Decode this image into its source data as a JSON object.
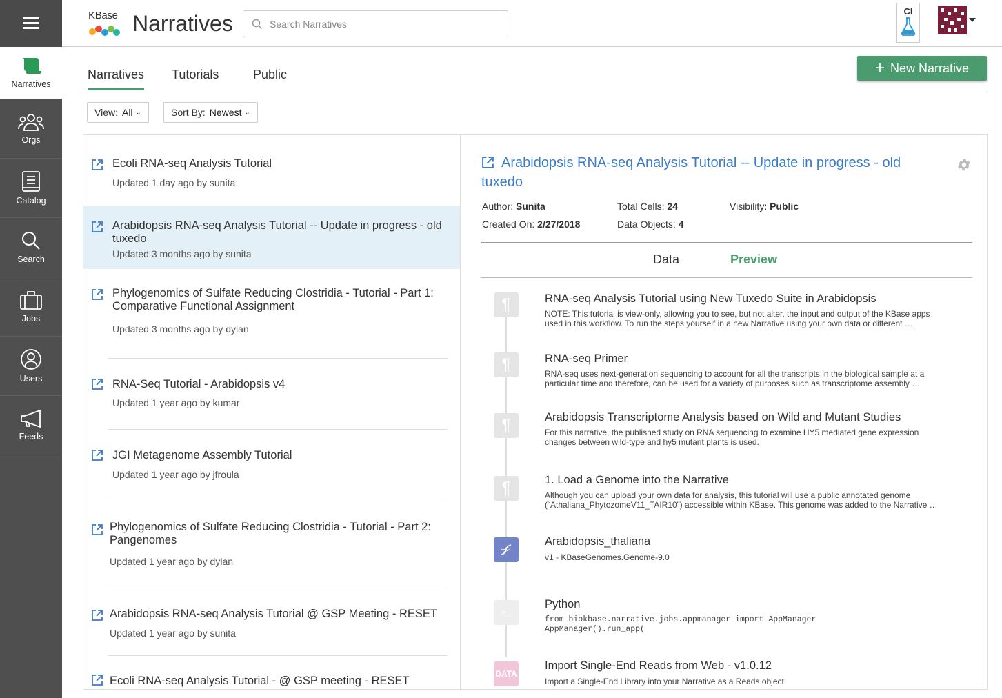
{
  "sidebar": {
    "items": [
      {
        "label": "Narratives",
        "icon": "narrative-icon",
        "active": true
      },
      {
        "label": "Orgs",
        "icon": "orgs-icon"
      },
      {
        "label": "Catalog",
        "icon": "catalog-icon"
      },
      {
        "label": "Search",
        "icon": "search-icon"
      },
      {
        "label": "Jobs",
        "icon": "jobs-icon"
      },
      {
        "label": "Users",
        "icon": "users-icon"
      },
      {
        "label": "Feeds",
        "icon": "feeds-icon"
      }
    ]
  },
  "header": {
    "logo_text": "KBase",
    "title": "Narratives",
    "search_placeholder": "Search Narratives",
    "env_label": "CI"
  },
  "tabs": [
    {
      "label": "Narratives",
      "active": true
    },
    {
      "label": "Tutorials"
    },
    {
      "label": "Public"
    }
  ],
  "new_button": {
    "label": "New Narrative"
  },
  "filters": {
    "view_label": "View:",
    "view_value": "All",
    "sort_label": "Sort By:",
    "sort_value": "Newest"
  },
  "narratives": [
    {
      "title": "Ecoli RNA-seq Analysis Tutorial",
      "meta": "Updated 1 day ago by sunita"
    },
    {
      "title": "Arabidopsis RNA-seq Analysis Tutorial -- Update in progress - old tuxedo",
      "meta": "Updated 3 months ago by sunita",
      "selected": true
    },
    {
      "title": "Phylogenomics of Sulfate Reducing Clostridia - Tutorial - Part 1: Comparative Functional Assignment",
      "meta": "Updated 3 months ago by dylan"
    },
    {
      "title": "RNA-Seq Tutorial - Arabidopsis v4",
      "meta": "Updated 1 year ago by kumar"
    },
    {
      "title": "JGI Metagenome Assembly Tutorial",
      "meta": "Updated 1 year ago by jfroula"
    },
    {
      "title": "Phylogenomics of Sulfate Reducing Clostridia - Tutorial - Part 2: Pangenomes",
      "meta": "Updated 1 year ago by dylan"
    },
    {
      "title": "Arabidopsis RNA-seq Analysis Tutorial @ GSP Meeting - RESET",
      "meta": "Updated 1 year ago by sunita"
    },
    {
      "title": "Ecoli RNA-seq Analysis Tutorial - @ GSP meeting - RESET Version",
      "meta": ""
    }
  ],
  "detail": {
    "title": "Arabidopsis RNA-seq Analysis Tutorial -- Update in progress - old tuxedo",
    "author_label": "Author:",
    "author": "Sunita",
    "created_label": "Created On:",
    "created": "2/27/2018",
    "cells_label": "Total Cells:",
    "cells": "24",
    "objects_label": "Data Objects:",
    "objects": "4",
    "visibility_label": "Visibility:",
    "visibility": "Public",
    "subtabs": [
      {
        "label": "Data"
      },
      {
        "label": "Preview",
        "active": true
      }
    ],
    "accent_color": "#4a9b6e",
    "link_color": "#3a7cc8",
    "cells_list": [
      {
        "type": "markdown",
        "title": "RNA-seq Analysis Tutorial using New Tuxedo Suite in Arabidopsis",
        "desc": "NOTE: This tutorial is view-only, allowing you to see, but not alter, the input and output of the KBase apps used in this workflow. To run the steps yourself in a new Narrative using your own data or different …"
      },
      {
        "type": "markdown",
        "title": "RNA-seq Primer",
        "desc": "RNA-seq uses next-generation sequencing to account for all the transcripts in the biological sample at a particular time and therefore, can be used for a variety of purposes such as transcriptome assembly …"
      },
      {
        "type": "markdown",
        "title": "Arabidopsis Transcriptome Analysis based on Wild and Mutant Studies",
        "desc": "For this narrative, the published study on RNA sequencing to examine HY5 mediated gene expression changes between wild-type and hy5 mutant plants is used."
      },
      {
        "type": "markdown",
        "title": "1. Load a Genome into the Narrative",
        "desc": "Although you can upload your own data for analysis, this tutorial will use a public annotated genome (“Athaliana_PhytozomeV11_TAIR10”) accessible within KBase. This genome was added to the Narrative …"
      },
      {
        "type": "data",
        "title": "Arabidopsis_thaliana",
        "desc": "v1 - KBaseGenomes.Genome-9.0"
      },
      {
        "type": "code",
        "title": "Python",
        "code": "from biokbase.narrative.jobs.appmanager import AppManager\nAppManager().run_app("
      },
      {
        "type": "app",
        "title": "Import Single-End Reads from Web - v1.0.12",
        "desc": "Import a Single-End Library into your Narrative as a Reads object.",
        "badge": "DATA"
      }
    ]
  }
}
